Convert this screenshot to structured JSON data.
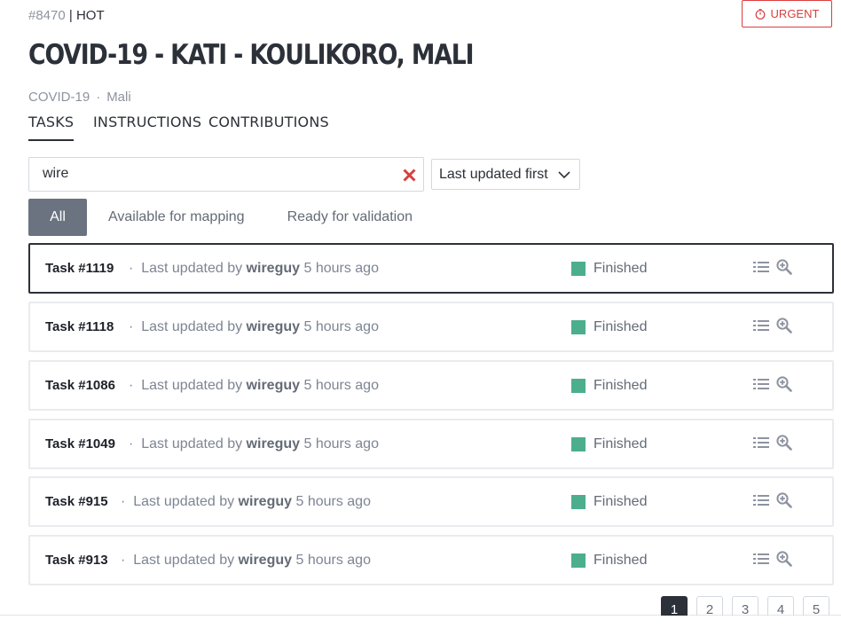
{
  "project": {
    "id": "#8470",
    "separator": " | ",
    "org": "HOT",
    "title": "COVID-19 - KATI - KOULIKORO, MALI",
    "campaign": "COVID-19",
    "dot": "·",
    "country": "Mali",
    "urgent_label": "URGENT"
  },
  "tabs": [
    {
      "label": "TASKS"
    },
    {
      "label": "INSTRUCTIONS"
    },
    {
      "label": "CONTRIBUTIONS"
    }
  ],
  "search": {
    "value": "wire"
  },
  "sort": {
    "selected": "Last updated first"
  },
  "filters": [
    {
      "label": "All"
    },
    {
      "label": "Available for mapping"
    },
    {
      "label": "Ready for validation"
    }
  ],
  "tasks": [
    {
      "name": "Task #1119",
      "prefix": "Last updated by",
      "user": "wireguy",
      "time": "5 hours ago",
      "status": "Finished"
    },
    {
      "name": "Task #1118",
      "prefix": "Last updated by",
      "user": "wireguy",
      "time": "5 hours ago",
      "status": "Finished"
    },
    {
      "name": "Task #1086",
      "prefix": "Last updated by",
      "user": "wireguy",
      "time": "5 hours ago",
      "status": "Finished"
    },
    {
      "name": "Task #1049",
      "prefix": "Last updated by",
      "user": "wireguy",
      "time": "5 hours ago",
      "status": "Finished"
    },
    {
      "name": "Task #915",
      "prefix": "Last updated by",
      "user": "wireguy",
      "time": "5 hours ago",
      "status": "Finished"
    },
    {
      "name": "Task #913",
      "prefix": "Last updated by",
      "user": "wireguy",
      "time": "5 hours ago",
      "status": "Finished"
    }
  ],
  "pagination": {
    "pages": [
      "1",
      "2",
      "3",
      "4",
      "5"
    ],
    "current": "1"
  },
  "colors": {
    "finished": "#4cae8c",
    "urgent": "#d73f3f",
    "clear": "#d73f3f"
  },
  "icons": {
    "urgent": "timer-icon",
    "clear": "close-icon",
    "sort": "chevron-down-icon",
    "task_list": "list-icon",
    "task_zoom": "zoom-in-icon"
  }
}
